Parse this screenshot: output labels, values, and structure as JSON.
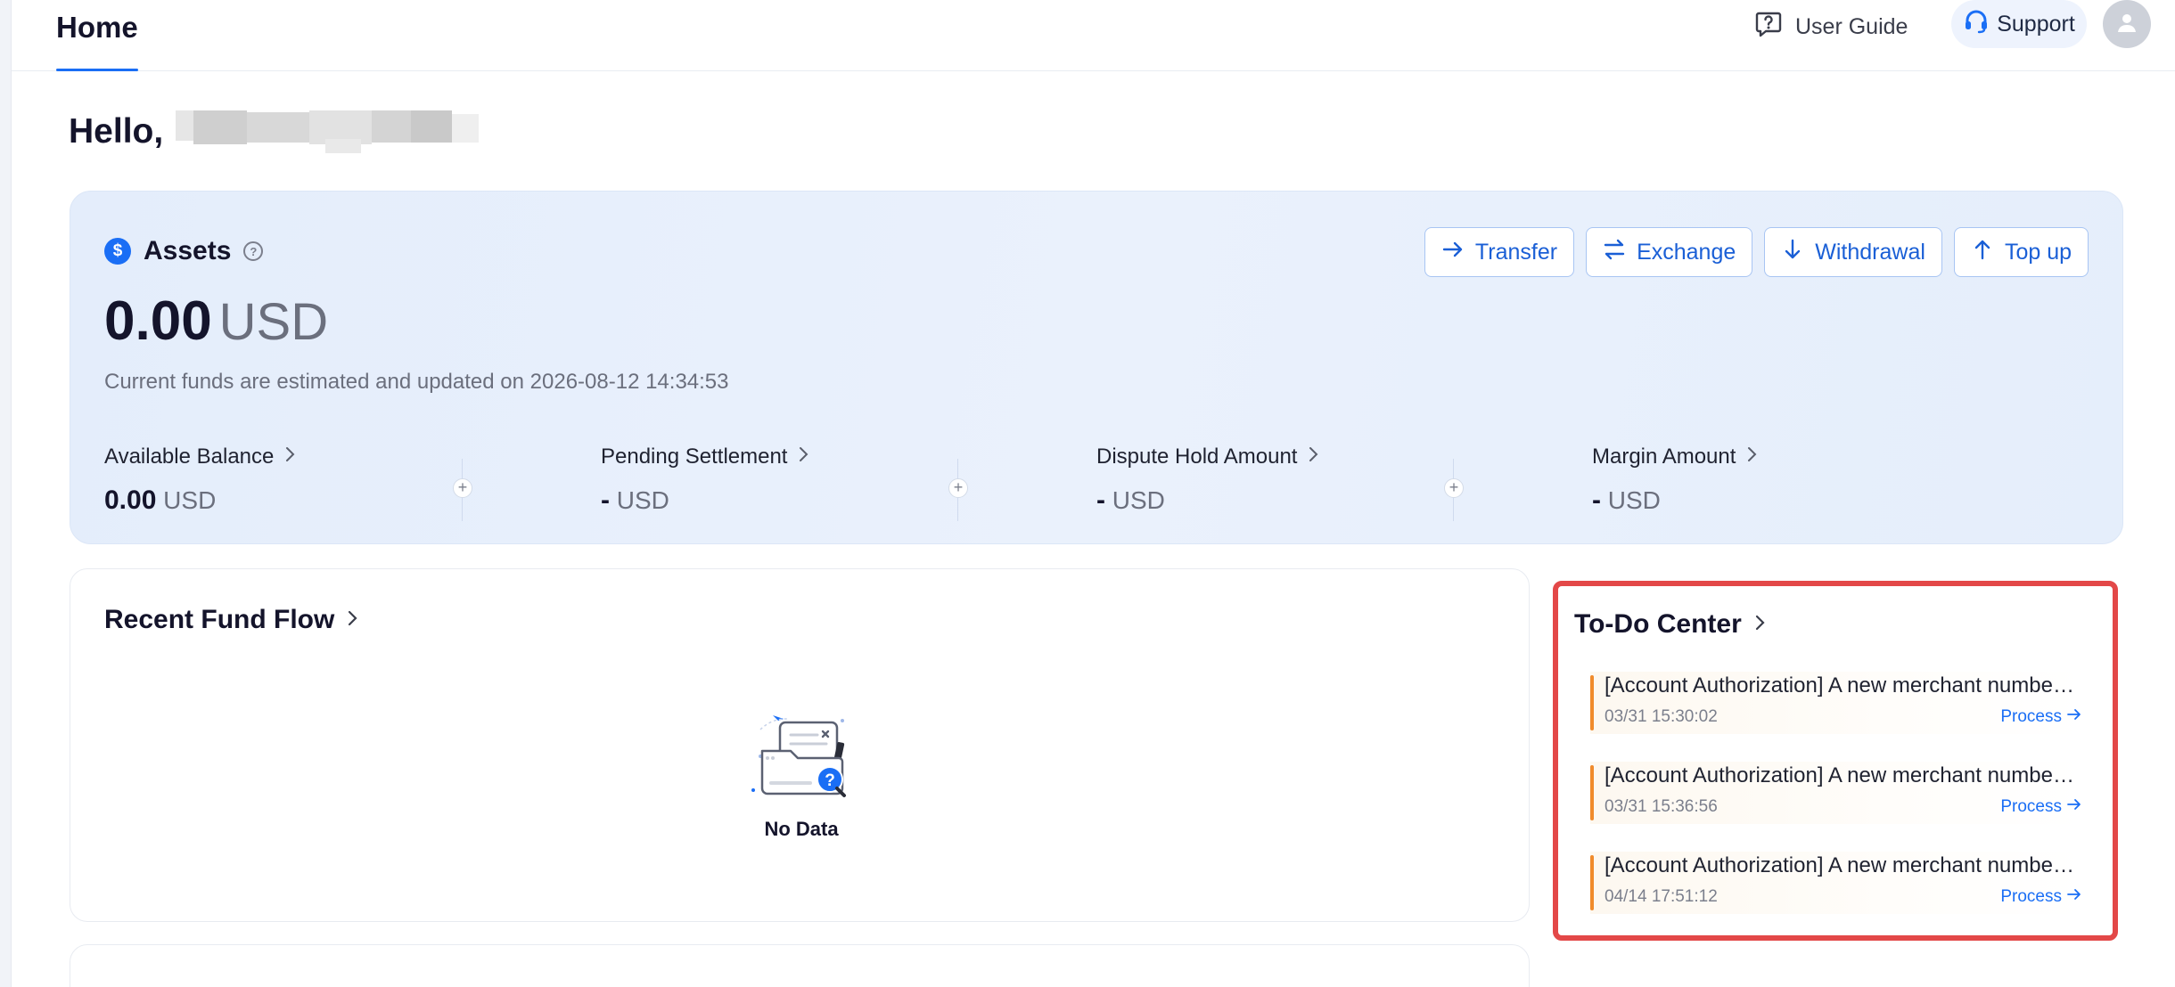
{
  "header": {
    "tab": "Home",
    "user_guide": "User Guide",
    "support": "Support"
  },
  "greeting": {
    "text": "Hello,"
  },
  "assets": {
    "title": "Assets",
    "amount": "0.00",
    "currency": "USD",
    "updated_text": "Current funds are estimated and updated on 2026-08-12 14:34:53",
    "actions": {
      "transfer": "Transfer",
      "exchange": "Exchange",
      "withdrawal": "Withdrawal",
      "topup": "Top up"
    },
    "metrics": [
      {
        "label": "Available Balance",
        "value": "0.00",
        "currency": "USD"
      },
      {
        "label": "Pending Settlement",
        "value": "-",
        "currency": "USD"
      },
      {
        "label": "Dispute Hold Amount",
        "value": "-",
        "currency": "USD"
      },
      {
        "label": "Margin Amount",
        "value": "-",
        "currency": "USD"
      }
    ]
  },
  "fund_flow": {
    "title": "Recent Fund Flow",
    "empty_label": "No Data"
  },
  "todo": {
    "title": "To-Do Center",
    "process_label": "Process",
    "items": [
      {
        "text": "[Account Authorization] A new merchant number has been added and needs authorization",
        "time": "03/31 15:30:02"
      },
      {
        "text": "[Account Authorization] A new merchant number has been added and needs authorization",
        "time": "03/31 15:36:56"
      },
      {
        "text": "[Account Authorization] A new merchant number has been added and needs authorization",
        "time": "04/14 17:51:12"
      }
    ]
  },
  "colors": {
    "accent": "#1a6ef5",
    "todo_border": "#e34848",
    "todo_marker": "#f08b2c"
  },
  "icons": {
    "user_guide": "question-chat-icon",
    "support": "headset-icon",
    "avatar": "user-icon",
    "assets": "dollar-icon",
    "transfer": "arrow-right-icon",
    "exchange": "swap-icon",
    "withdrawal": "arrow-down-icon",
    "topup": "arrow-up-icon"
  }
}
